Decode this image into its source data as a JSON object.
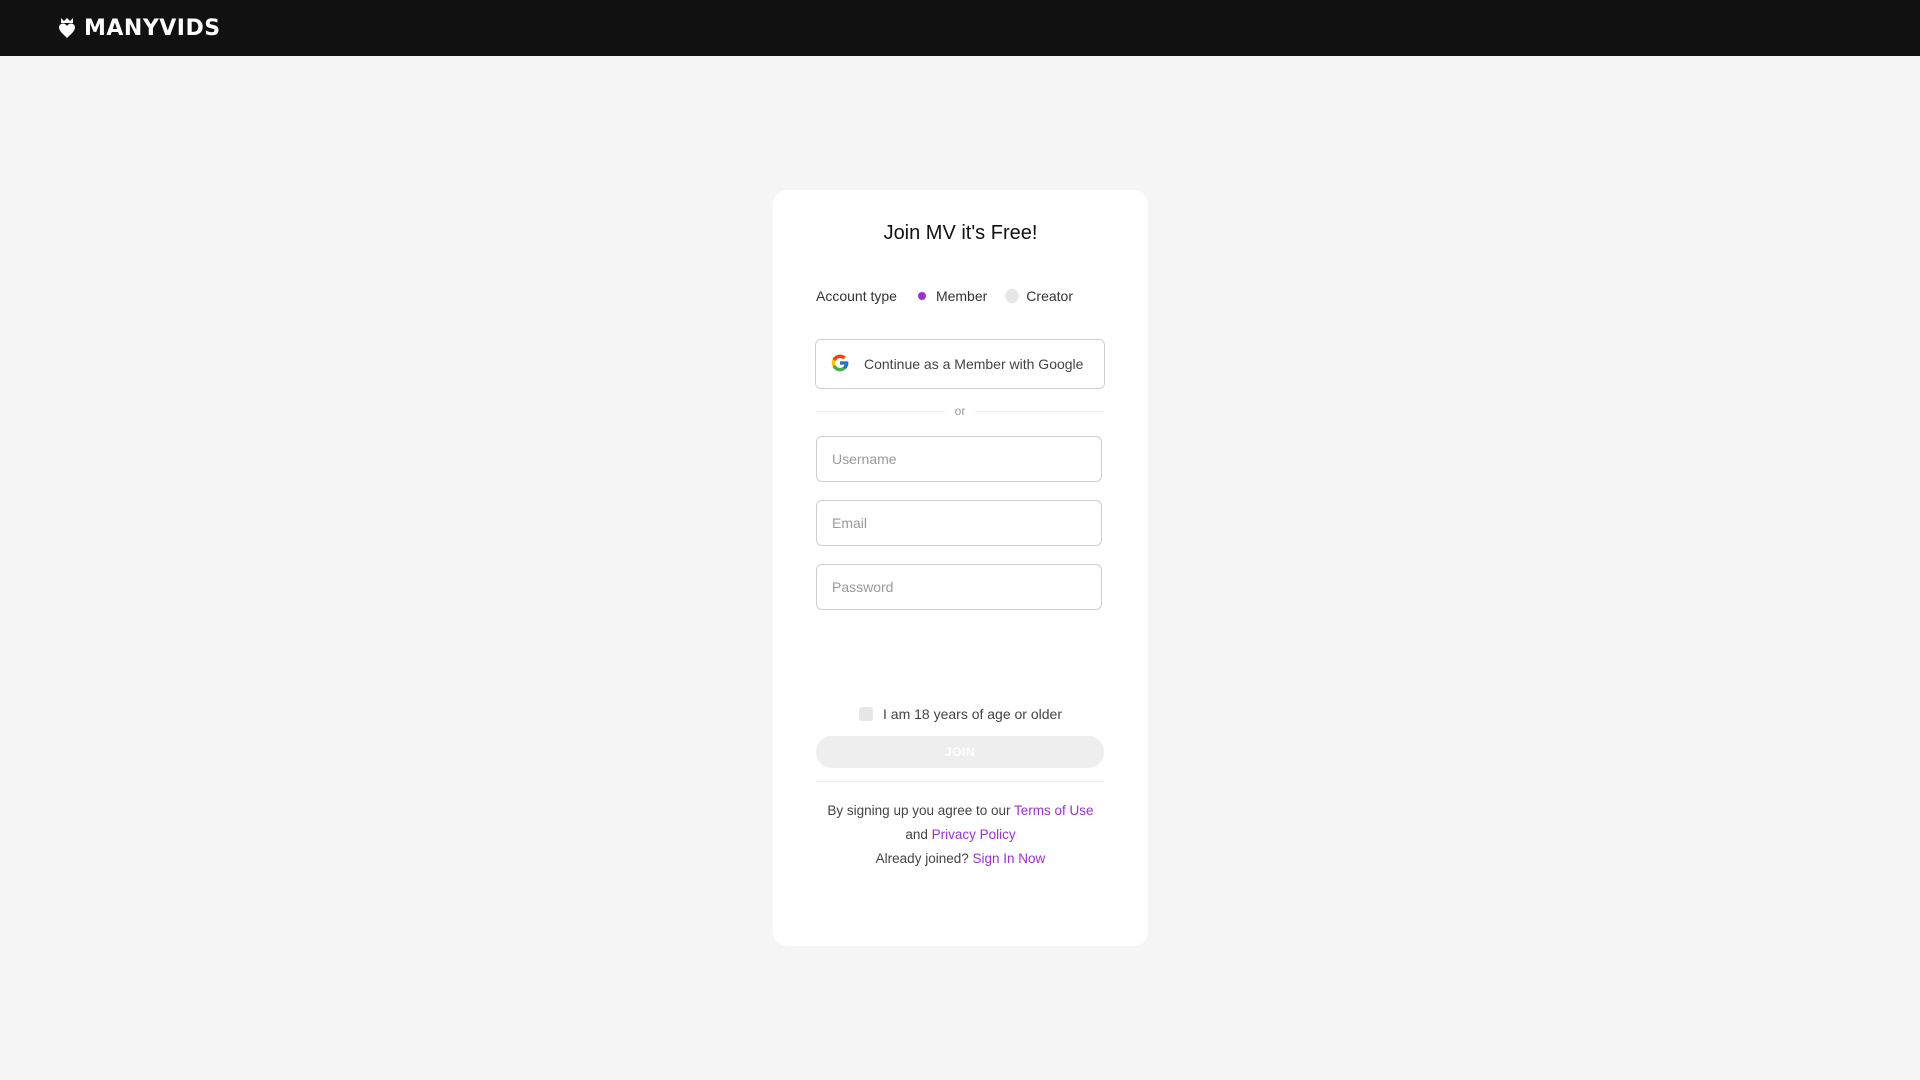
{
  "header": {
    "brand": "MANYVIDS",
    "logo_icon": "heart-crown-logo-icon"
  },
  "signup": {
    "title": "Join MV it's Free!",
    "account_type_label": "Account type",
    "options": [
      "Member",
      "Creator"
    ],
    "selected_option": "Member",
    "google_button_label": "Continue as a Member with Google",
    "google_icon": "google-g-icon",
    "or_label": "or",
    "username_placeholder": "Username",
    "email_placeholder": "Email",
    "password_placeholder": "Password",
    "age_confirm_label": "I am 18 years of age or older",
    "join_button_label": "JOIN",
    "legal_prefix": "By signing up you agree to our",
    "terms_link": "Terms of Use",
    "and_text": "and",
    "privacy_link": "Privacy Policy",
    "already_joined": "Already joined?",
    "sign_in_link": "Sign In Now"
  },
  "colors": {
    "accent": "#9b30d9",
    "header_bg": "#111111",
    "page_bg": "#f5f5f5"
  }
}
